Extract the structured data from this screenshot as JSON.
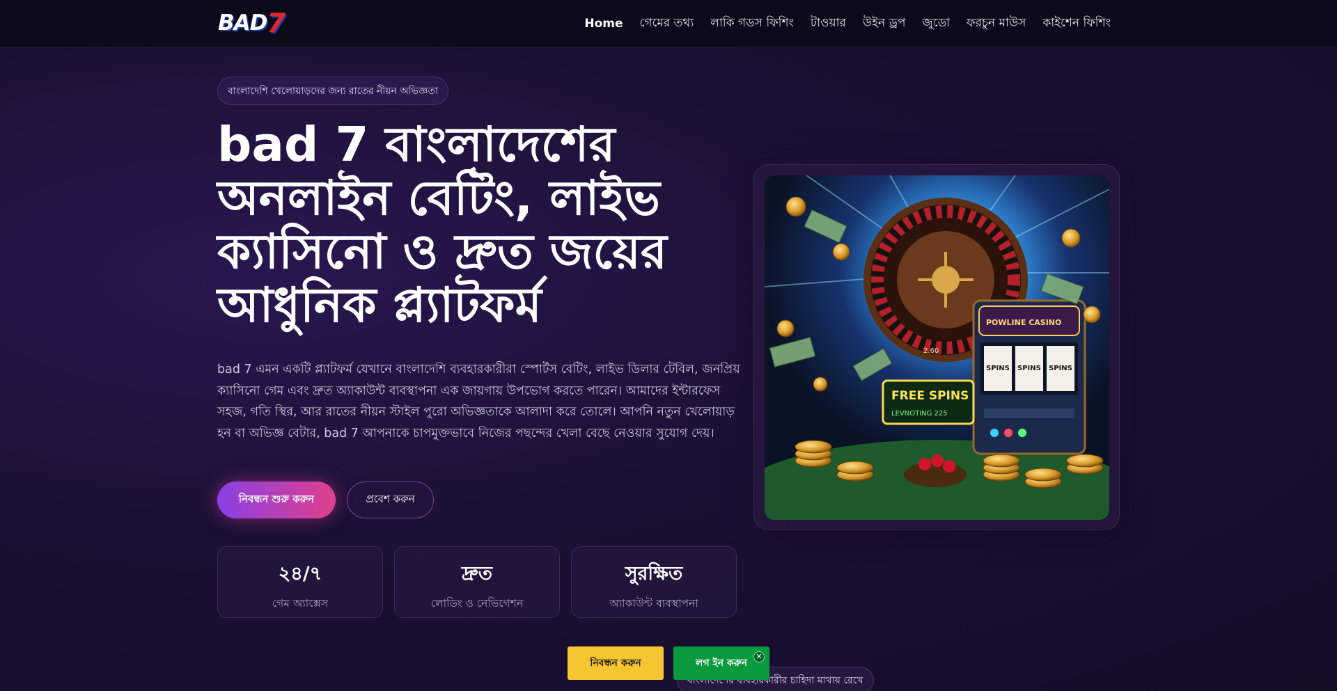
{
  "header": {
    "logo_main": "BAD",
    "logo_seven": "7",
    "nav": [
      {
        "label": "Home",
        "active": true
      },
      {
        "label": "গেমের তথ্য",
        "active": false
      },
      {
        "label": "লাকি গডস ফিশিং",
        "active": false
      },
      {
        "label": "টাওয়ার",
        "active": false
      },
      {
        "label": "উইন ড্রপ",
        "active": false
      },
      {
        "label": "জুডো",
        "active": false
      },
      {
        "label": "ফরচুন মাউস",
        "active": false
      },
      {
        "label": "কাইশেন ফিশিং",
        "active": false
      }
    ]
  },
  "hero": {
    "tagline": "বাংলাদেশি খেলোয়াড়দের জন্য রাতের নীয়ন অভিজ্ঞতা",
    "title": "bad 7 বাংলাদেশের অনলাইন বেটিং, লাইভ ক্যাসিনো ও দ্রুত জয়ের আধুনিক প্ল্যাটফর্ম",
    "description": "bad 7 এমন একটি প্ল্যাটফর্ম যেখানে বাংলাদেশি ব্যবহারকারীরা স্পোর্টস বেটিং, লাইভ ডিলার টেবিল, জনপ্রিয় ক্যাসিনো গেম এবং দ্রুত অ্যাকাউন্ট ব্যবস্থাপনা এক জায়গায় উপভোগ করতে পারেন। আমাদের ইন্টারফেস সহজ, গতি স্থির, আর রাতের নীয়ন স্টাইল পুরো অভিজ্ঞতাকে আলাদা করে তোলে। আপনি নতুন খেলোয়াড় হন বা অভিজ্ঞ বেটার, bad 7 আপনাকে চাপমুক্তভাবে নিজের পছন্দের খেলা বেছে নেওয়ার সুযোগ দেয়।",
    "primary_button": "নিবন্ধন শুরু করুন",
    "secondary_button": "প্রবেশ করুন",
    "stats": [
      {
        "value": "২৪/৭",
        "label": "গেম অ্যাক্সেস"
      },
      {
        "value": "দ্রুত",
        "label": "লোডিং ও নেভিগেশন"
      },
      {
        "value": "সুরক্ষিত",
        "label": "অ্যাকাউন্ট ব্যবস্থাপনা"
      }
    ],
    "image": {
      "slot_reel_1": "SPINS",
      "slot_reel_2": "SPINS",
      "slot_reel_3": "SPINS",
      "slot_sign": "POWLINE CASINO",
      "freespins_line1": "FREE SPINS",
      "freespins_line2": "LEVNOTING 225",
      "roulette_number": "2.60"
    }
  },
  "sticky_bar": {
    "register_label": "নিবন্ধন করুন",
    "login_label": "লগ ইন করুন",
    "close_symbol": "✕"
  },
  "section_pill": "বাংলাদেশের ব্যবহারকারীর চাহিদা মাথায় রেখে",
  "colors": {
    "accent_gradient_start": "#8a3fe6",
    "accent_gradient_end": "#e0408a",
    "register_yellow": "#f6c532",
    "login_green": "#0a9a3e",
    "logo_red": "#e3262f"
  }
}
